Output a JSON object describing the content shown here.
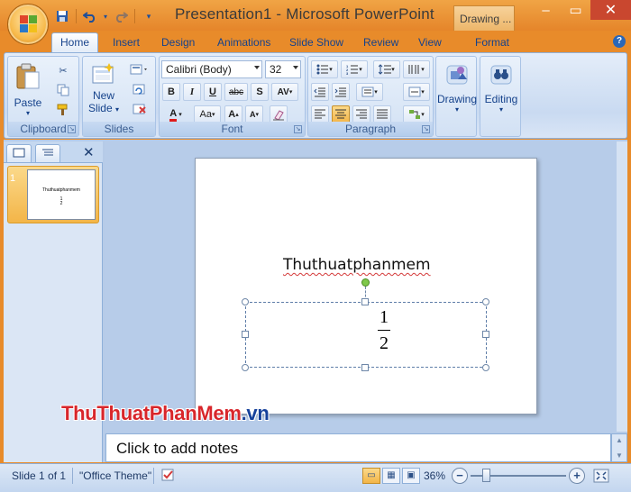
{
  "window": {
    "title": "Presentation1 - Microsoft PowerPoint",
    "contextual_tab": "Drawing ..."
  },
  "quick_access": {
    "items": [
      "save-icon",
      "undo-icon",
      "redo-icon",
      "customize-icon"
    ]
  },
  "tabs": [
    {
      "label": "Home",
      "active": true
    },
    {
      "label": "Insert"
    },
    {
      "label": "Design"
    },
    {
      "label": "Animations"
    },
    {
      "label": "Slide Show"
    },
    {
      "label": "Review"
    },
    {
      "label": "View"
    },
    {
      "label": "Format"
    }
  ],
  "ribbon": {
    "clipboard": {
      "label": "Clipboard",
      "paste_label": "Paste"
    },
    "slides": {
      "label": "Slides",
      "new_slide_line1": "New",
      "new_slide_line2": "Slide"
    },
    "font": {
      "label": "Font",
      "font_name": "Calibri (Body)",
      "font_size": "32",
      "bold": "B",
      "italic": "I",
      "underline": "U",
      "strike": "abc",
      "shadow": "S",
      "spacing": "AV",
      "color_glyph": "A",
      "case_glyph": "Aa",
      "grow_glyph": "A",
      "shrink_glyph": "A",
      "font_color_hex": "#e01b1b"
    },
    "paragraph": {
      "label": "Paragraph"
    },
    "drawing": {
      "label": "Drawing"
    },
    "editing": {
      "label": "Editing"
    }
  },
  "slide_pane": {
    "slide_number": "1",
    "thumb_title": "Thuthuatphanmem",
    "thumb_numerator": "1",
    "thumb_denominator": "2"
  },
  "slide": {
    "title": "Thuthuatphanmem",
    "numerator": "1",
    "denominator": "2"
  },
  "notes": {
    "placeholder": "Click to add notes"
  },
  "watermark": {
    "part1": "ThuThuat",
    "part2": "PhanMem",
    "part3": ".vn"
  },
  "status": {
    "slide_info": "Slide 1 of 1",
    "theme": "\"Office Theme\"",
    "zoom": "36%"
  },
  "colors": {
    "window_frame": "#e88b2a",
    "accent_highlight": "#f3b548",
    "ribbon_blue": "#c9daf1"
  }
}
